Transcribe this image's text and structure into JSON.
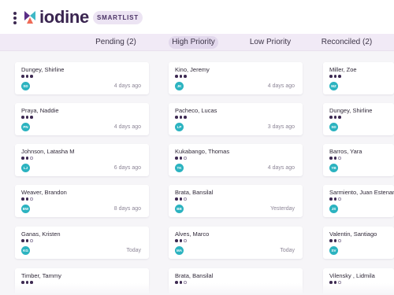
{
  "app": {
    "brand": "iodine",
    "smartlist_label": "SMARTLIST"
  },
  "tabs": [
    {
      "label": "Pending (2)",
      "active": false
    },
    {
      "label": "High Priority",
      "active": true
    },
    {
      "label": "Low Priority",
      "active": false
    },
    {
      "label": "Reconciled (2)",
      "active": false
    }
  ],
  "columns": [
    {
      "cards": [
        {
          "name": "Dungey, Shirline",
          "initials": "SD",
          "time": "4 days ago",
          "priority": 3
        },
        {
          "name": "Praya, Naddie",
          "initials": "PN",
          "time": "4 days ago",
          "priority": 3
        },
        {
          "name": "Johnson, Latasha M",
          "initials": "LJ",
          "time": "6 days ago",
          "priority": 2
        },
        {
          "name": "Weaver, Brandon",
          "initials": "BW",
          "time": "8 days ago",
          "priority": 2
        },
        {
          "name": "Ganas, Kristen",
          "initials": "KG",
          "time": "Today",
          "priority": 2
        },
        {
          "name": "Timber, Tammy",
          "initials": "",
          "time": "",
          "priority": 3
        }
      ]
    },
    {
      "cards": [
        {
          "name": "Kino, Jeremy",
          "initials": "JK",
          "time": "4 days ago",
          "priority": 3
        },
        {
          "name": "Pacheco, Lucas",
          "initials": "LP",
          "time": "3 days ago",
          "priority": 3
        },
        {
          "name": "Kukabango, Thomas",
          "initials": "TK",
          "time": "4 days ago",
          "priority": 2
        },
        {
          "name": "Brata, Bansilal",
          "initials": "BB",
          "time": "Yesterday",
          "priority": 2
        },
        {
          "name": "Alves, Marco",
          "initials": "MA",
          "time": "Today",
          "priority": 2
        },
        {
          "name": "Brata, Bansilal",
          "initials": "",
          "time": "",
          "priority": 2
        }
      ]
    },
    {
      "cards": [
        {
          "name": "Miller, Zoe",
          "initials": "MZ",
          "time": "",
          "priority": 3
        },
        {
          "name": "Dungey, Shirline",
          "initials": "SD",
          "time": "",
          "priority": 3
        },
        {
          "name": "Barros, Yara",
          "initials": "YB",
          "time": "",
          "priority": 2
        },
        {
          "name": "Sarmiento, Juan Estenan",
          "initials": "JS",
          "time": "",
          "priority": 2
        },
        {
          "name": "Valentin, Santiago",
          "initials": "SV",
          "time": "",
          "priority": 2
        },
        {
          "name": "Vilensky , Lidmila",
          "initials": "",
          "time": "",
          "priority": 2
        }
      ]
    }
  ]
}
